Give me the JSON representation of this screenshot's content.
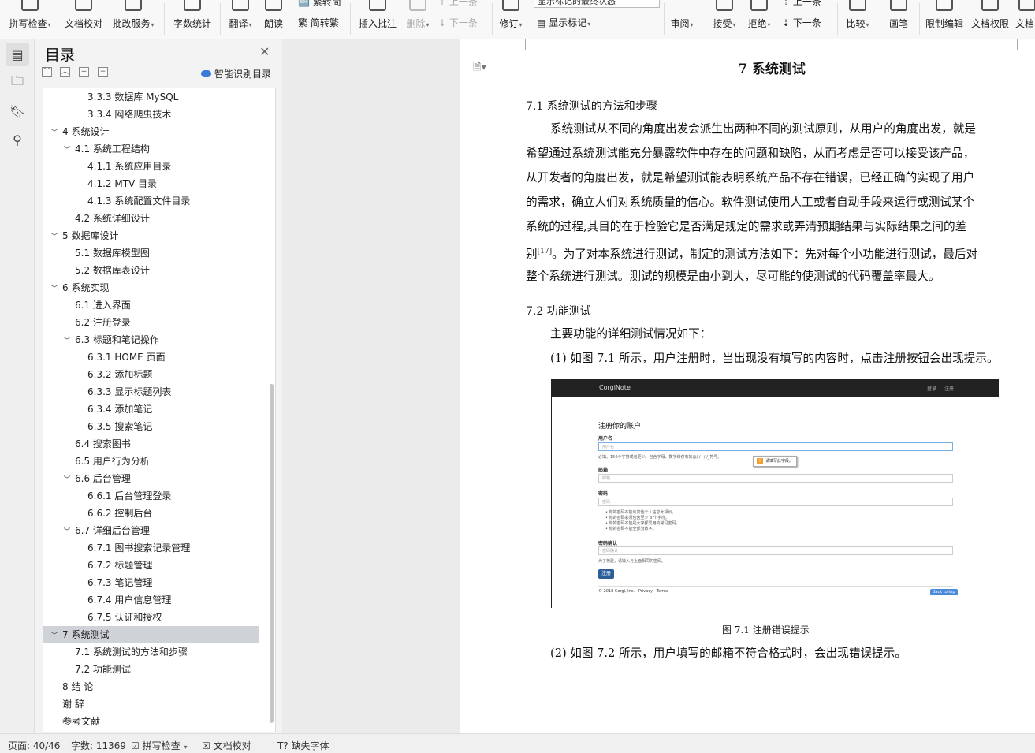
{
  "ribbon": {
    "buttons": [
      {
        "label": "拼写检查",
        "arrow": "▾"
      },
      {
        "label": "文档校对",
        "arrow": ""
      },
      {
        "label": "批改服务",
        "arrow": "▾"
      },
      {
        "label": "字数统计",
        "arrow": ""
      },
      {
        "label": "翻译",
        "arrow": "▾"
      },
      {
        "label": "朗读",
        "arrow": ""
      },
      {
        "label": "插入批注",
        "arrow": ""
      },
      {
        "label": "删除",
        "arrow": "▾"
      },
      {
        "label": "修订",
        "arrow": "▾"
      },
      {
        "label": "审阅",
        "arrow": "▾"
      },
      {
        "label": "接受",
        "arrow": "▾"
      },
      {
        "label": "拒绝",
        "arrow": "▾"
      },
      {
        "label": "比较",
        "arrow": "▾"
      },
      {
        "label": "画笔",
        "arrow": ""
      },
      {
        "label": "限制编辑",
        "arrow": ""
      },
      {
        "label": "文档权限",
        "arrow": ""
      },
      {
        "label": "文档",
        "arrow": ""
      }
    ],
    "simp_to_trad": "简转繁",
    "trad_to_simp": "繁转简",
    "prev": "上一条",
    "next": "下一条",
    "accept_next": "下一条",
    "accept_prev": "上一条",
    "show_markup": "显示标记",
    "markup_combo": "显示标记的最终状态"
  },
  "toc": {
    "title": "目录",
    "smart_label": "智能识别目录",
    "items": [
      {
        "text": "3.3.3  数据库 MySQL",
        "twisty": ""
      },
      {
        "text": "3.3.4  网络爬虫技术",
        "twisty": ""
      },
      {
        "text": "4 系统设计",
        "twisty": "﹀"
      },
      {
        "text": "4.1  系统工程结构",
        "twisty": "﹀"
      },
      {
        "text": "4.1.1  系统应用目录",
        "twisty": ""
      },
      {
        "text": "4.1.2 MTV 目录",
        "twisty": ""
      },
      {
        "text": "4.1.3  系统配置文件目录",
        "twisty": ""
      },
      {
        "text": "4.2  系统详细设计",
        "twisty": ""
      },
      {
        "text": "5 数据库设计",
        "twisty": "﹀"
      },
      {
        "text": "5.1  数据库模型图",
        "twisty": ""
      },
      {
        "text": "5.2  数据库表设计",
        "twisty": ""
      },
      {
        "text": "6 系统实现",
        "twisty": "﹀"
      },
      {
        "text": "6.1 进入界面",
        "twisty": ""
      },
      {
        "text": "6.2 注册登录",
        "twisty": ""
      },
      {
        "text": "6.3  标题和笔记操作",
        "twisty": "﹀"
      },
      {
        "text": "6.3.1 HOME 页面",
        "twisty": ""
      },
      {
        "text": "6.3.2  添加标题",
        "twisty": ""
      },
      {
        "text": "6.3.3  显示标题列表",
        "twisty": ""
      },
      {
        "text": "6.3.4  添加笔记",
        "twisty": ""
      },
      {
        "text": "6.3.5  搜索笔记",
        "twisty": ""
      },
      {
        "text": "6.4  搜索图书",
        "twisty": ""
      },
      {
        "text": "6.5  用户行为分析",
        "twisty": ""
      },
      {
        "text": "6.6  后台管理",
        "twisty": "﹀"
      },
      {
        "text": "6.6.1 后台管理登录",
        "twisty": ""
      },
      {
        "text": "6.6.2  控制后台",
        "twisty": ""
      },
      {
        "text": "6.7  详细后台管理",
        "twisty": "﹀"
      },
      {
        "text": "6.7.1  图书搜索记录管理",
        "twisty": ""
      },
      {
        "text": "6.7.2  标题管理",
        "twisty": ""
      },
      {
        "text": "6.7.3  笔记管理",
        "twisty": ""
      },
      {
        "text": "6.7.4  用户信息管理",
        "twisty": ""
      },
      {
        "text": "6.7.5  认证和授权",
        "twisty": ""
      },
      {
        "text": "7 系统测试",
        "twisty": "﹀"
      },
      {
        "text": "7.1  系统测试的方法和步骤",
        "twisty": ""
      },
      {
        "text": "7.2  功能测试",
        "twisty": ""
      },
      {
        "text": "8 结  论",
        "twisty": ""
      },
      {
        "text": "谢  辞",
        "twisty": ""
      },
      {
        "text": "参考文献",
        "twisty": ""
      }
    ]
  },
  "document": {
    "heading": "7 系统测试",
    "sec1": "7.1  系统测试的方法和步骤",
    "para1": [
      "系统测试从不同的角度出发会派生出两种不同的测试原则，从用户的角度出发，就是",
      "希望通过系统测试能充分暴露软件中存在的问题和缺陷，从而考虑是否可以接受该产品，",
      "从开发者的角度出发，就是希望测试能表明系统产品不存在错误，已经正确的实现了用户",
      "的需求，确立人们对系统质量的信心。软件测试使用人工或者自动手段来运行或测试某个",
      "系统的过程,其目的在于检验它是否满足规定的需求或弄清预期结果与实际结果之间的差"
    ],
    "para1_ref_pre": "别",
    "para1_ref": "[17]",
    "para1_ref_post": "。为了对本系统进行测试，制定的测试方法如下：先对每个小功能进行测试，最后对",
    "para1_last": "整个系统进行测试。测试的规模是由小到大，尽可能的使测试的代码覆盖率最大。",
    "sec2": "7.2  功能测试",
    "para2": "主要功能的详细测试情况如下：",
    "item1": "(1) 如图 7.1 所示，用户注册时，当出现没有填写的内容时，点击注册按钮会出现提示。",
    "caption": "图 7.1  注册错误提示",
    "item2": "(2) 如图 7.2 所示，用户填写的邮箱不符合格式时，会出现错误提示。"
  },
  "figure": {
    "brand": "CorgiNote",
    "nav_login": "登录",
    "nav_register": "注册",
    "form_title": "注册你的账户.",
    "username_label": "用户名",
    "username_placeholder": "用户名",
    "username_help": "必填。150个字符或者更少。包含字母、数字和仅有的@/./+/-/_符号。",
    "tooltip": "请填写此字段。",
    "email_label": "邮箱",
    "email_placeholder": "邮箱",
    "password_label": "密码",
    "password_placeholder": "密码",
    "password_rules": [
      "你的密码不能与其他个人信息太相似。",
      "你的密码必须包含至少 8 个字符。",
      "你的密码不能是大家都爱用的常见密码。",
      "你的密码不能全部为数字。"
    ],
    "confirm_label": "密码确认",
    "confirm_placeholder": "密码确认",
    "confirm_help": "为了校验，请输入与上面相同的密码。",
    "submit": "注册",
    "footer": "© 2018 Corgi, Inc. · Privacy · Terms",
    "back_to_top": "Back to top"
  },
  "status": {
    "page": "页面: 40/46",
    "words": "字数: 11369",
    "spell": "拼写检查",
    "proof": "文档校对",
    "missing_font": "缺失字体"
  },
  "colors": {
    "selection": "#cfd3d8",
    "figure_bar": "#222222",
    "submit_button": "#2b5d99"
  }
}
